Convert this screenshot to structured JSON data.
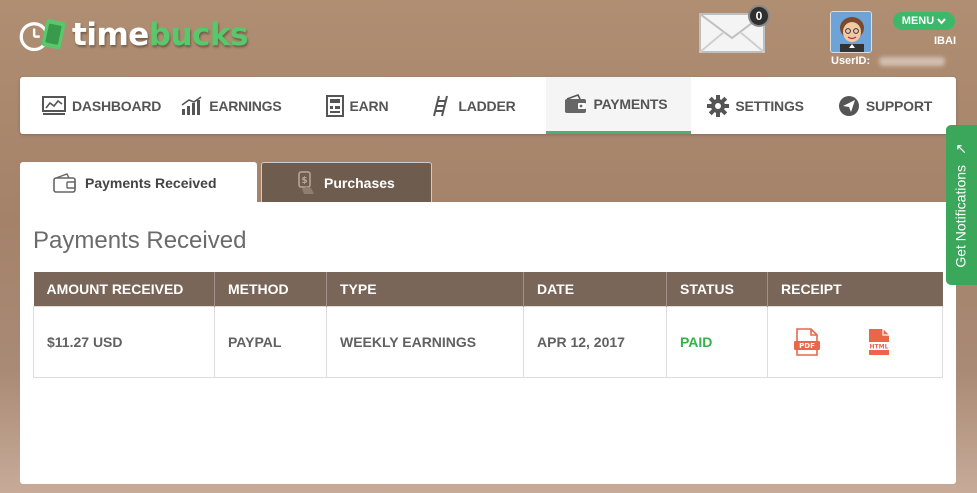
{
  "brand": {
    "name_part1": "time",
    "name_part2": "bucks",
    "accent": "#58c96a"
  },
  "header": {
    "mail_badge": "0",
    "menu_label": "MENU",
    "username": "IBAI",
    "userid_label": "UserID:"
  },
  "nav": {
    "items": [
      {
        "label": "DASHBOARD",
        "icon": "dashboard-icon"
      },
      {
        "label": "EARNINGS",
        "icon": "earnings-icon"
      },
      {
        "label": "EARN",
        "icon": "earn-icon"
      },
      {
        "label": "LADDER",
        "icon": "ladder-icon"
      },
      {
        "label": "PAYMENTS",
        "icon": "wallet-icon",
        "active": true
      },
      {
        "label": "SETTINGS",
        "icon": "gear-icon"
      },
      {
        "label": "SUPPORT",
        "icon": "support-icon"
      }
    ]
  },
  "tabs": {
    "received": "Payments Received",
    "purchases": "Purchases"
  },
  "main": {
    "title": "Payments Received",
    "table": {
      "headers": [
        "AMOUNT RECEIVED",
        "METHOD",
        "TYPE",
        "DATE",
        "STATUS",
        "RECEIPT"
      ],
      "rows": [
        {
          "amount": "$11.27 USD",
          "method": "PAYPAL",
          "type": "WEEKLY EARNINGS",
          "date": "APR 12, 2017",
          "status": "PAID",
          "receipt_pdf": "PDF",
          "receipt_html": "HTML"
        }
      ]
    }
  },
  "side_tab": {
    "label": "Get Notifications"
  },
  "colors": {
    "table_header": "#7a6658",
    "paid": "#35b24a",
    "active_nav": "#4fae75",
    "receipt_icon": "#e8674a"
  }
}
